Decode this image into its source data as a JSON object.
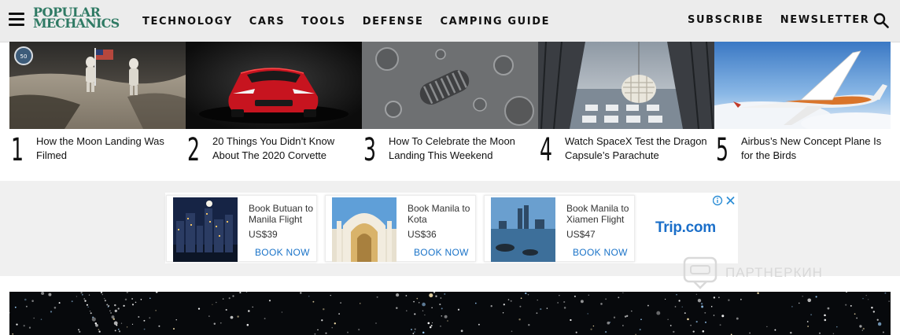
{
  "header": {
    "logo_line1": "POPULAR",
    "logo_line2": "MECHANICS",
    "nav": [
      "TECHNOLOGY",
      "CARS",
      "TOOLS",
      "DEFENSE",
      "CAMPING GUIDE"
    ],
    "right_nav": [
      "SUBSCRIBE",
      "NEWSLETTER"
    ],
    "icons": [
      "hamburger-menu-icon",
      "search-icon"
    ]
  },
  "stories": [
    {
      "number": "1",
      "title": "How the Moon Landing Was Filmed"
    },
    {
      "number": "2",
      "title": "20 Things You Didn’t Know About The 2020 Corvette"
    },
    {
      "number": "3",
      "title": "How To Celebrate the Moon Landing This Weekend"
    },
    {
      "number": "4",
      "title": "Watch SpaceX Test the Dragon Capsule’s Parachute"
    },
    {
      "number": "5",
      "title": "Airbus’s New Concept Plane Is for the Birds"
    }
  ],
  "ad": {
    "cards": [
      {
        "title": "Book Butuan to Manila Flight",
        "price": "US$39",
        "cta": "BOOK NOW"
      },
      {
        "title": "Book Manila to Kota Kinabalu...",
        "price": "US$36",
        "cta": "BOOK NOW"
      },
      {
        "title": "Book Manila to Xiamen Flight",
        "price": "US$47",
        "cta": "BOOK NOW"
      }
    ],
    "brand_name": "Trip",
    "brand_suffix": ".com",
    "watermark": "ПАРТНЕРКИН"
  },
  "colors": {
    "logo_green": "#2f7a64",
    "cta_blue": "#1a73c8",
    "header_bg": "#ececec",
    "ad_band_bg": "#f0f0f0"
  }
}
